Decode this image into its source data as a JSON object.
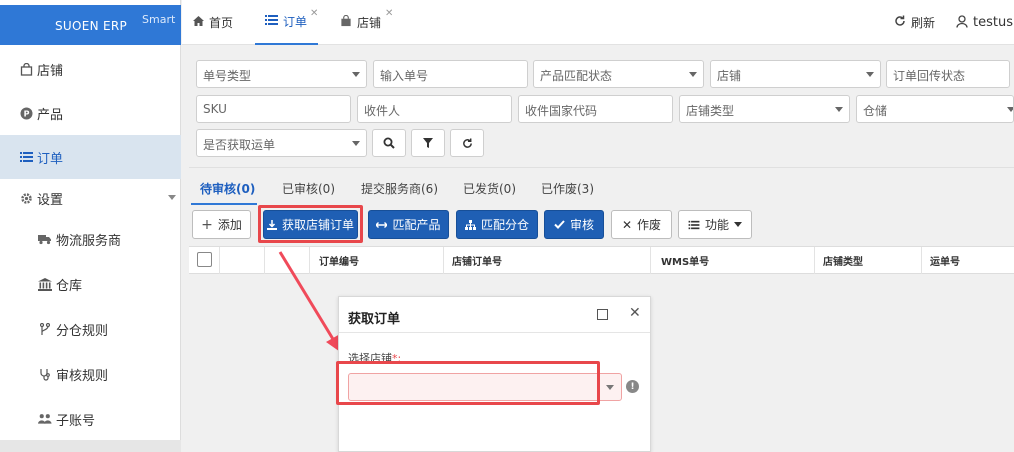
{
  "brand": {
    "name": "SUOEN ERP",
    "sub": "Smart"
  },
  "sidebar": {
    "items": [
      {
        "label": "店铺",
        "icon": "shop-bag-icon"
      },
      {
        "label": "产品",
        "icon": "product-p-icon"
      },
      {
        "label": "订单",
        "icon": "list-icon",
        "active": true
      },
      {
        "label": "设置",
        "icon": "gear-icon"
      },
      {
        "label": "物流服务商",
        "icon": "truck-icon"
      },
      {
        "label": "仓库",
        "icon": "bank-icon"
      },
      {
        "label": "分仓规则",
        "icon": "fork-icon"
      },
      {
        "label": "审核规则",
        "icon": "stethoscope-icon"
      },
      {
        "label": "子账号",
        "icon": "users-icon"
      }
    ]
  },
  "topbar": {
    "tabs": [
      {
        "label": "首页",
        "icon": "home-icon"
      },
      {
        "label": "订单",
        "icon": "list-icon",
        "active": true
      },
      {
        "label": "店铺",
        "icon": "shop-bag-icon"
      }
    ],
    "refresh_label": "刷新",
    "user_label": "testus"
  },
  "filters": {
    "order_type": "单号类型",
    "order_no": "输入单号",
    "match_status": "产品匹配状态",
    "shop": "店铺",
    "upload_status": "订单回传状态",
    "sku": "SKU",
    "receiver": "收件人",
    "country_code": "收件国家代码",
    "shop_type": "店铺类型",
    "warehouse": "仓储",
    "waybill": "是否获取运单"
  },
  "status_tabs": [
    {
      "label": "待审核(0)",
      "active": true
    },
    {
      "label": "已审核(0)"
    },
    {
      "label": "提交服务商(6)"
    },
    {
      "label": "已发货(0)"
    },
    {
      "label": "已作废(3)"
    }
  ],
  "actions": {
    "add": "添加",
    "fetch_shop_orders": "获取店铺订单",
    "match_product": "匹配产品",
    "match_warehouse": "匹配分仓",
    "approve": "审核",
    "void": "作废",
    "functions": "功能"
  },
  "table": {
    "headers": [
      "订单编号",
      "店铺订单号",
      "WMS单号",
      "店铺类型",
      "运单号"
    ]
  },
  "dialog": {
    "title": "获取订单",
    "field_label": "选择店铺",
    "required_mark": "*:",
    "select_value": ""
  },
  "colors": {
    "brand": "#2f78d6",
    "primary": "#1f5fb4",
    "highlight": "#e8474b"
  }
}
